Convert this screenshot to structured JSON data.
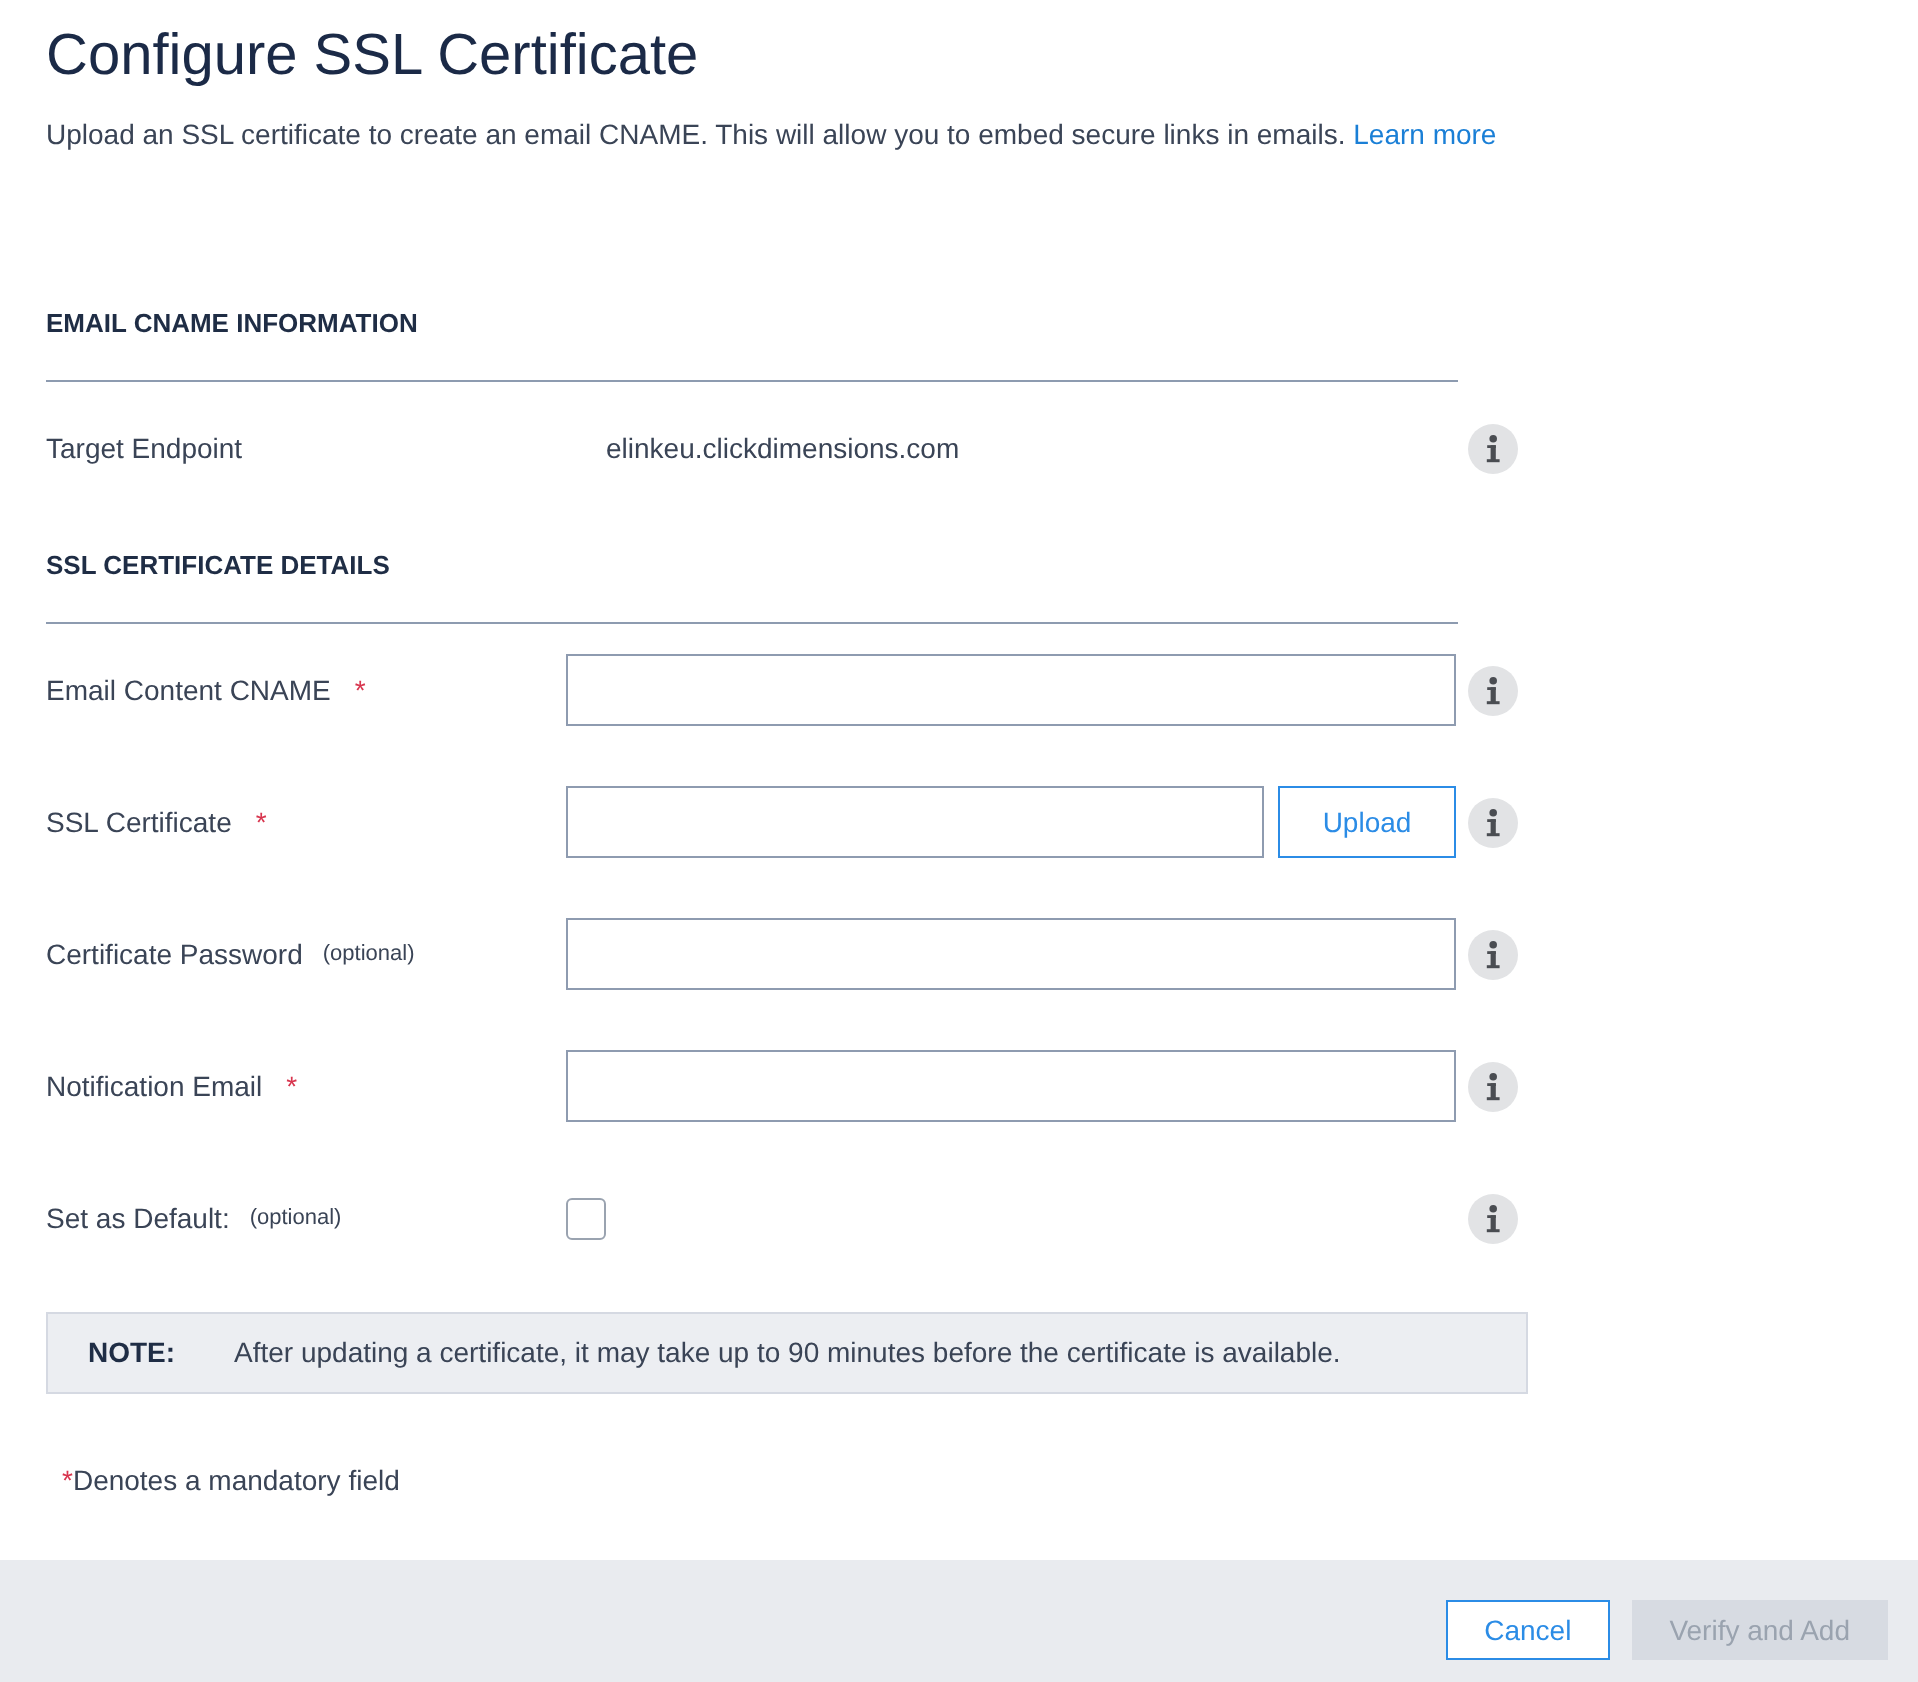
{
  "page": {
    "title": "Configure SSL Certificate",
    "intro": "Upload an SSL certificate to create an email CNAME. This will allow you to embed secure links in emails.",
    "learn_more_link": "Learn more"
  },
  "sections": [
    {
      "heading": "EMAIL CNAME INFORMATION",
      "rows": [
        {
          "kind": "readonly",
          "label": "Target Endpoint",
          "value": "elinkeu.clickdimensions.com"
        }
      ]
    },
    {
      "heading": "SSL CERTIFICATE DETAILS",
      "rows": [
        {
          "kind": "text",
          "label": "Email Content CNAME",
          "required_mark": "*"
        },
        {
          "kind": "upload",
          "label": "SSL Certificate",
          "required_mark": "*",
          "button": "Upload"
        },
        {
          "kind": "text",
          "label": "Certificate Password",
          "hint": "(optional)"
        },
        {
          "kind": "text",
          "label": "Notification Email",
          "required_mark": "*"
        },
        {
          "kind": "checkbox",
          "label": "Set as Default:",
          "hint": "(optional)",
          "checked": false
        }
      ]
    }
  ],
  "note": {
    "label": "NOTE:",
    "text": "After updating a certificate, it may take up to 90 minutes before the certificate is available."
  },
  "mandatory_note": {
    "mark": "*",
    "text": "Denotes a mandatory field"
  },
  "footer": {
    "buttons": [
      {
        "kind": "secondary",
        "label": "Cancel",
        "disabled": false
      },
      {
        "kind": "primary",
        "label": "Verify and Add",
        "disabled": true
      }
    ]
  }
}
